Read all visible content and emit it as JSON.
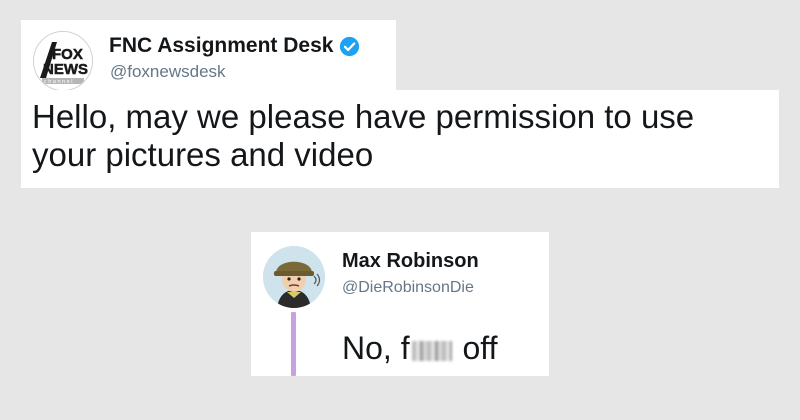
{
  "tweet_request": {
    "author": {
      "display_name": "FNC Assignment Desk",
      "handle": "@foxnewsdesk",
      "verified": true,
      "avatar_icon": "fox-news-logo-icon"
    },
    "text_line1": "Hello, may we please have permission to use",
    "text_line2": "your pictures and video"
  },
  "tweet_reply": {
    "author": {
      "display_name": "Max Robinson",
      "handle": "@DieRobinsonDie",
      "verified": false,
      "avatar_icon": "soldier-cartoon-avatar-icon"
    },
    "text_before": "No, f",
    "text_after": " off",
    "thread_line_color": "#c7a2e0"
  },
  "colors": {
    "background": "#e6e6e6",
    "verified_badge": "#1da1f2",
    "handle": "#657786"
  }
}
